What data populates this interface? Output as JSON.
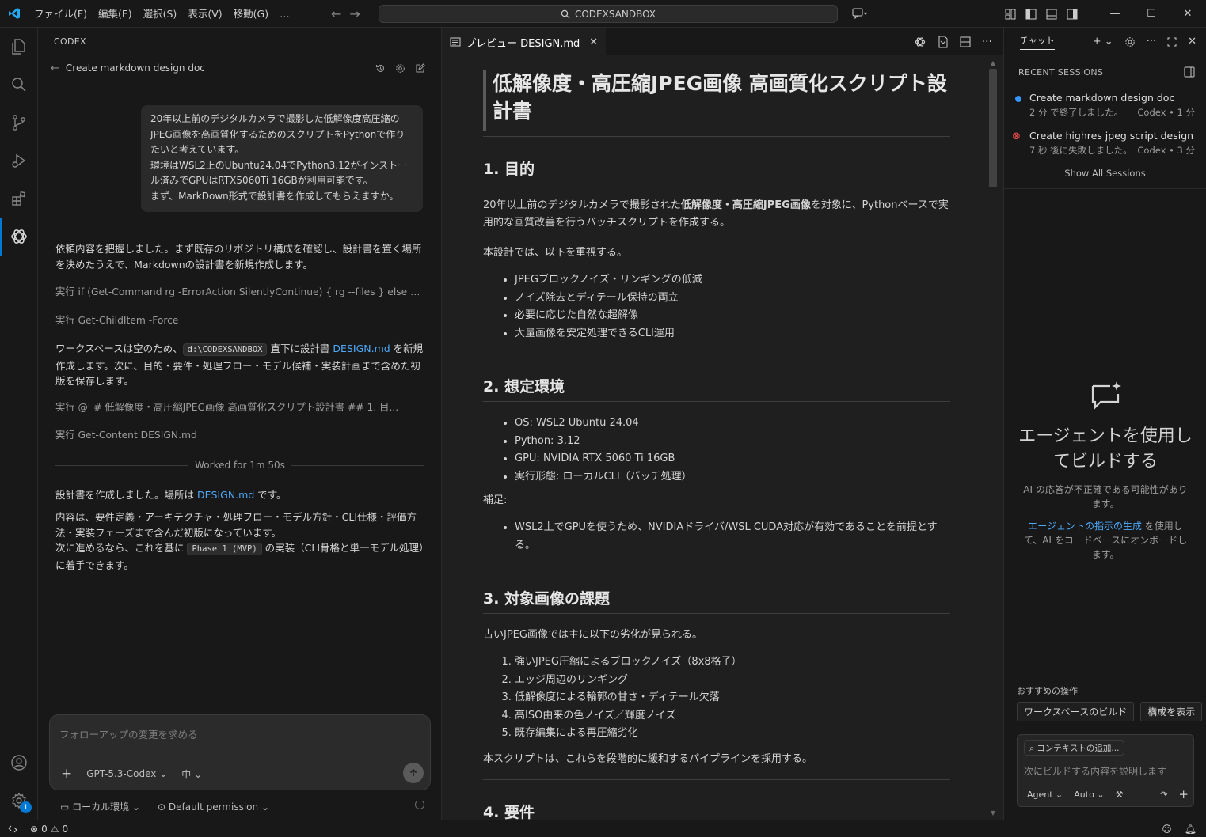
{
  "menu": [
    "ファイル(F)",
    "編集(E)",
    "選択(S)",
    "表示(V)",
    "移動(G)",
    "…"
  ],
  "command_center": "CODEXSANDBOX",
  "window_controls": {
    "minimize": "—",
    "maximize": "☐",
    "close": "✕"
  },
  "codex": {
    "header": "CODEX",
    "thread_title": "Create markdown design doc",
    "user_message": "20年以上前のデジタルカメラで撮影した低解像度高圧縮のJPEG画像を高画質化するためのスクリプトをPythonで作りたいと考えています。\n環境はWSL2上のUbuntu24.04でPython3.12がインストール済みでGPUはRTX5060Ti 16GBが利用可能です。\nまず、MarkDown形式で設計書を作成してもらえますか。",
    "msg1": "依頼内容を把握しました。まず既存のリポジトリ構成を確認し、設計書を置く場所を決めたうえで、Markdownの設計書を新規作成します。",
    "run1": "実行 if (Get-Command rg -ErrorAction SilentlyContinue) { rg --files } else { G...",
    "run2": "実行 Get-ChildItem -Force",
    "msg2_a": "ワークスペースは空のため、",
    "msg2_code": "d:\\CODEXSANDBOX",
    "msg2_b": " 直下に設計書 ",
    "msg2_link": "DESIGN.md",
    "msg2_c": " を新規作成します。次に、目的・要件・処理フロー・モデル候補・実装計画まで含めた初版を保存します。",
    "run3": "実行 @' # 低解像度・高圧縮JPEG画像 高画質化スクリプト設計書 ## 1. 目...",
    "run4": "実行 Get-Content DESIGN.md",
    "worked": "Worked for 1m 50s",
    "msg3_a": "設計書を作成しました。場所は ",
    "msg3_link": "DESIGN.md",
    "msg3_b": " です。",
    "msg4_a": "内容は、要件定義・アーキテクチャ・処理フロー・モデル方針・CLI仕様・評価方法・実装フェーズまで含んだ初版になっています。",
    "msg4_b": "次に進めるなら、これを基に ",
    "msg4_code": "Phase 1 (MVP)",
    "msg4_c": " の実装（CLI骨格と単一モデル処理）に着手できます。",
    "composer_placeholder": "フォローアップの変更を求める",
    "model": "GPT-5.3-Codex",
    "effort": "中",
    "env": "ローカル環境",
    "permission": "Default permission"
  },
  "editor": {
    "tab_label": "プレビュー DESIGN.md",
    "doc": {
      "title": "低解像度・高圧縮JPEG画像 高画質化スクリプト設計書",
      "s1": "1. 目的",
      "s1_p1_a": "20年以上前のデジタルカメラで撮影された",
      "s1_p1_b": "低解像度・高圧縮JPEG画像",
      "s1_p1_c": "を対象に、Pythonベースで実用的な画質改善を行うバッチスクリプトを作成する。",
      "s1_p2": "本設計では、以下を重視する。",
      "s1_list": [
        "JPEGブロックノイズ・リンギングの低減",
        "ノイズ除去とディテール保持の両立",
        "必要に応じた自然な超解像",
        "大量画像を安定処理できるCLI運用"
      ],
      "s2": "2. 想定環境",
      "s2_list": [
        "OS: WSL2 Ubuntu 24.04",
        "Python: 3.12",
        "GPU: NVIDIA RTX 5060 Ti 16GB",
        "実行形態: ローカルCLI（バッチ処理）"
      ],
      "s2_note": "補足:",
      "s2_note_list": [
        "WSL2上でGPUを使うため、NVIDIAドライバ/WSL CUDA対応が有効であることを前提とする。"
      ],
      "s3": "3. 対象画像の課題",
      "s3_p1": "古いJPEG画像では主に以下の劣化が見られる。",
      "s3_list": [
        "強いJPEG圧縮によるブロックノイズ（8x8格子）",
        "エッジ周辺のリンギング",
        "低解像度による輪郭の甘さ・ディテール欠落",
        "高ISO由来の色ノイズ／輝度ノイズ",
        "既存編集による再圧縮劣化"
      ],
      "s3_p2": "本スクリプトは、これらを段階的に緩和するパイプラインを採用する。",
      "s4": "4. 要件"
    }
  },
  "chat": {
    "tab": "チャット",
    "recent_sessions": "RECENT SESSIONS",
    "sessions": [
      {
        "title": "Create markdown design doc",
        "status": "2 分 で終了しました。",
        "meta": "Codex • 1 分"
      },
      {
        "title": "Create highres jpeg script design",
        "status": "7 秒 後に失敗しました。",
        "meta": "Codex • 3 分"
      }
    ],
    "show_all": "Show All Sessions",
    "empty_title": "エージェントを使用してビルドする",
    "empty_note": "AI の応答が不正確である可能性があります。",
    "empty_link": "エージェントの指示の生成",
    "empty_rest": " を使用して、AI をコードベースにオンボードします。",
    "suggest_label": "おすすめの操作",
    "suggestions": [
      "ワークスペースのビルド",
      "構成を表示"
    ],
    "context_btn": "コンテキストの追加...",
    "input_placeholder": "次にビルドする内容を説明します",
    "mode": "Agent",
    "model": "Auto"
  },
  "status": {
    "errors": "0",
    "warnings": "0"
  },
  "colors": {
    "accent": "#0078d4",
    "link": "#4daafc",
    "error": "#f14c4c"
  }
}
